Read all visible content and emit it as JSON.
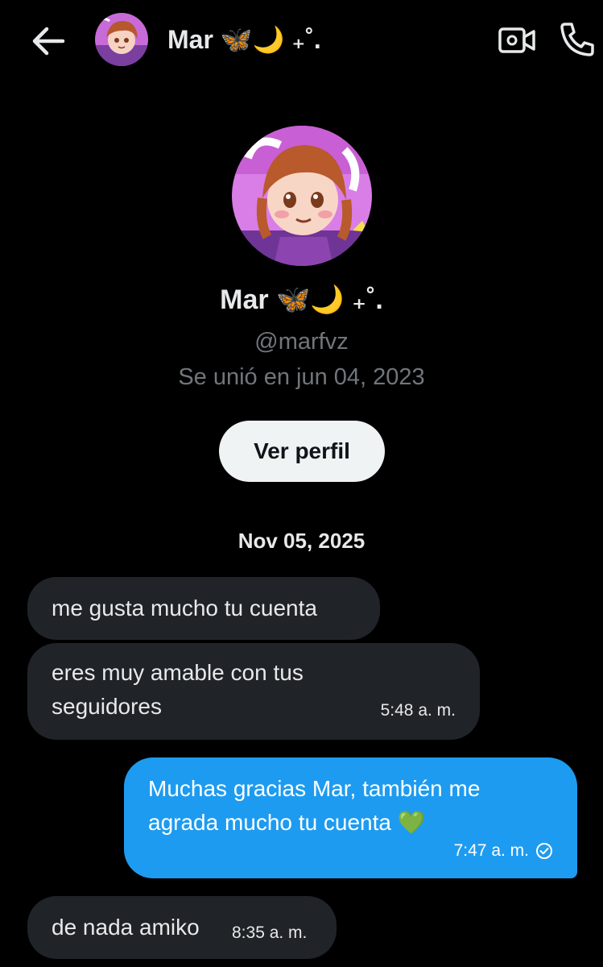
{
  "header": {
    "name": "Mar 🦋🌙 ₊˚.",
    "back_icon": "arrow-left-icon",
    "video_icon": "video-call-icon",
    "call_icon": "phone-icon"
  },
  "profile": {
    "name": "Mar 🦋🌙 ₊˚.",
    "handle": "@marfvz",
    "joined": "Se unió en jun 04, 2023",
    "view_profile_label": "Ver perfil"
  },
  "conversation": {
    "date": "Nov 05, 2025",
    "messages": [
      {
        "direction": "in",
        "text": "me gusta mucho tu cuenta",
        "time": ""
      },
      {
        "direction": "in",
        "text": "eres muy amable con tus seguidores",
        "time": "5:48 a. m."
      },
      {
        "direction": "out",
        "text": "Muchas gracias Mar, también me agrada mucho tu cuenta 💚",
        "time": "7:47 a. m.",
        "status_icon": "read-check-icon"
      },
      {
        "direction": "in",
        "text": "de nada amiko",
        "time": "8:35 a. m."
      }
    ]
  },
  "colors": {
    "background": "#000000",
    "incoming_bubble": "#202327",
    "outgoing_bubble": "#1d9bf0",
    "muted_text": "#71767b",
    "button_bg": "#eff3f4"
  }
}
